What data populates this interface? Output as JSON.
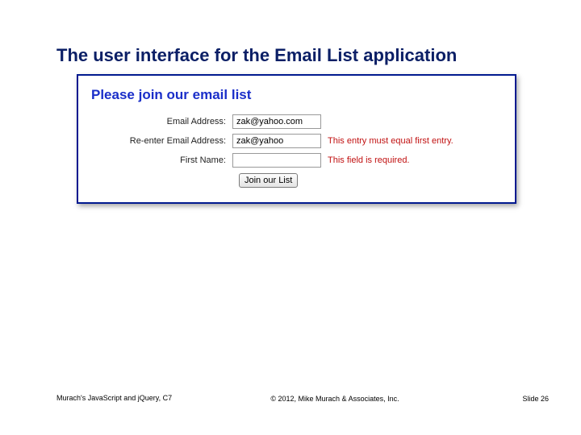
{
  "title": "The user interface for the Email List application",
  "panel": {
    "heading": "Please join our email list",
    "rows": [
      {
        "label": "Email Address:",
        "value": "zak@yahoo.com",
        "message": ""
      },
      {
        "label": "Re-enter Email Address:",
        "value": "zak@yahoo",
        "message": "This entry must equal first entry."
      },
      {
        "label": "First Name:",
        "value": "",
        "message": "This field is required."
      }
    ],
    "button_label": "Join our List"
  },
  "footer": {
    "book": "Murach's JavaScript and jQuery, C7",
    "copyright": "© 2012, Mike Murach & Associates, Inc.",
    "slide": "Slide 26"
  }
}
